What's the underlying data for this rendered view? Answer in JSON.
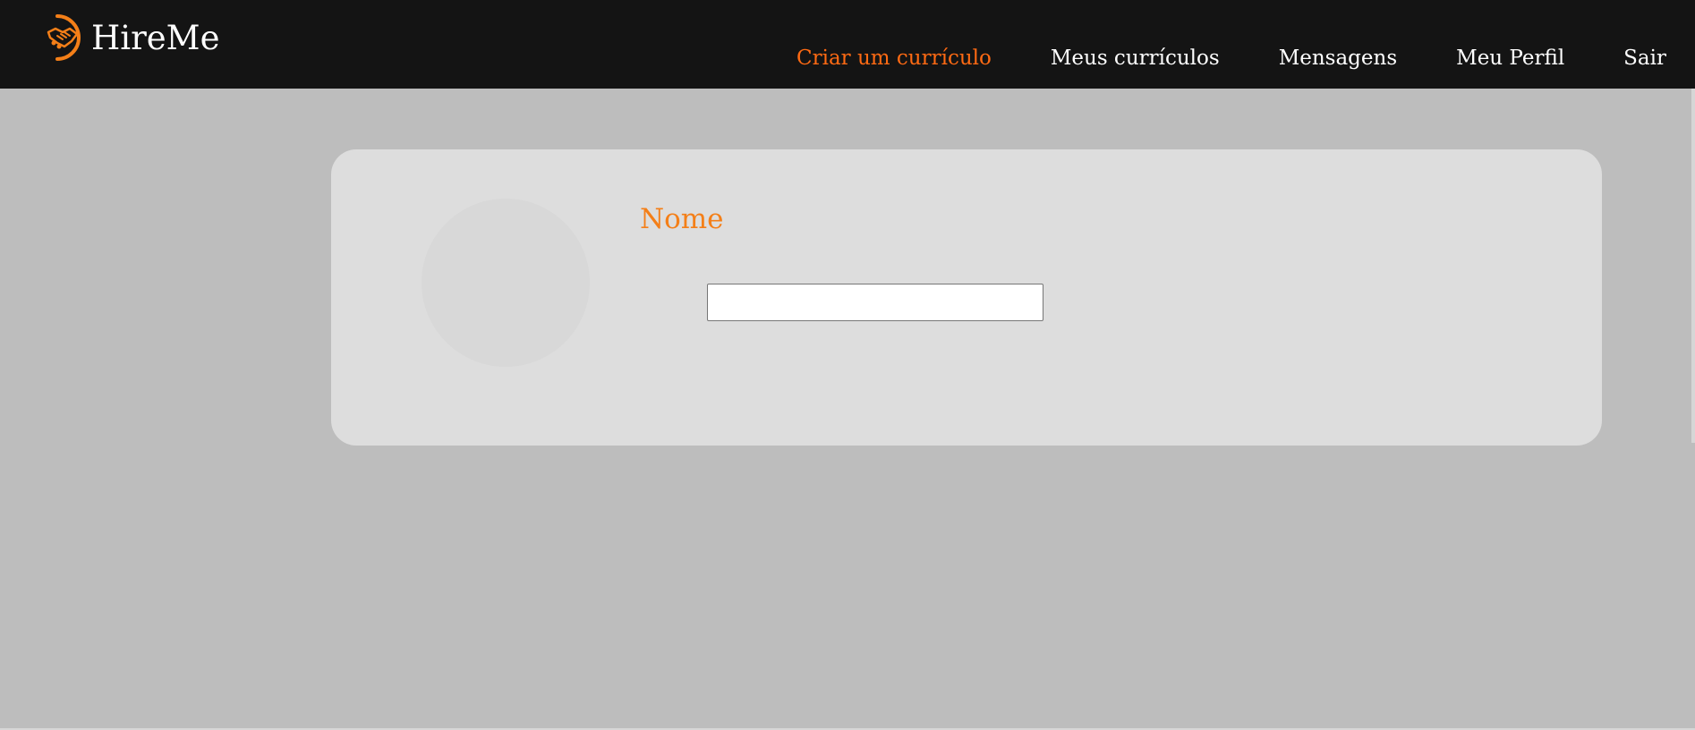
{
  "brand": {
    "name": "HireMe",
    "icon": "handshake-icon",
    "icon_color": "#f47f18"
  },
  "nav": {
    "items": [
      {
        "label": "Criar um currículo",
        "active": true
      },
      {
        "label": "Meus currículos",
        "active": false
      },
      {
        "label": "Mensagens",
        "active": false
      },
      {
        "label": "Meu Perfil",
        "active": false
      },
      {
        "label": "Sair",
        "active": false
      }
    ]
  },
  "form": {
    "name_label": "Nome",
    "name_value": "",
    "name_placeholder": ""
  },
  "colors": {
    "navbar_bg": "#141414",
    "accent": "#ff6a13",
    "label": "#f47f18",
    "page_bg": "#bdbdbd",
    "card_bg": "#dddddd"
  }
}
